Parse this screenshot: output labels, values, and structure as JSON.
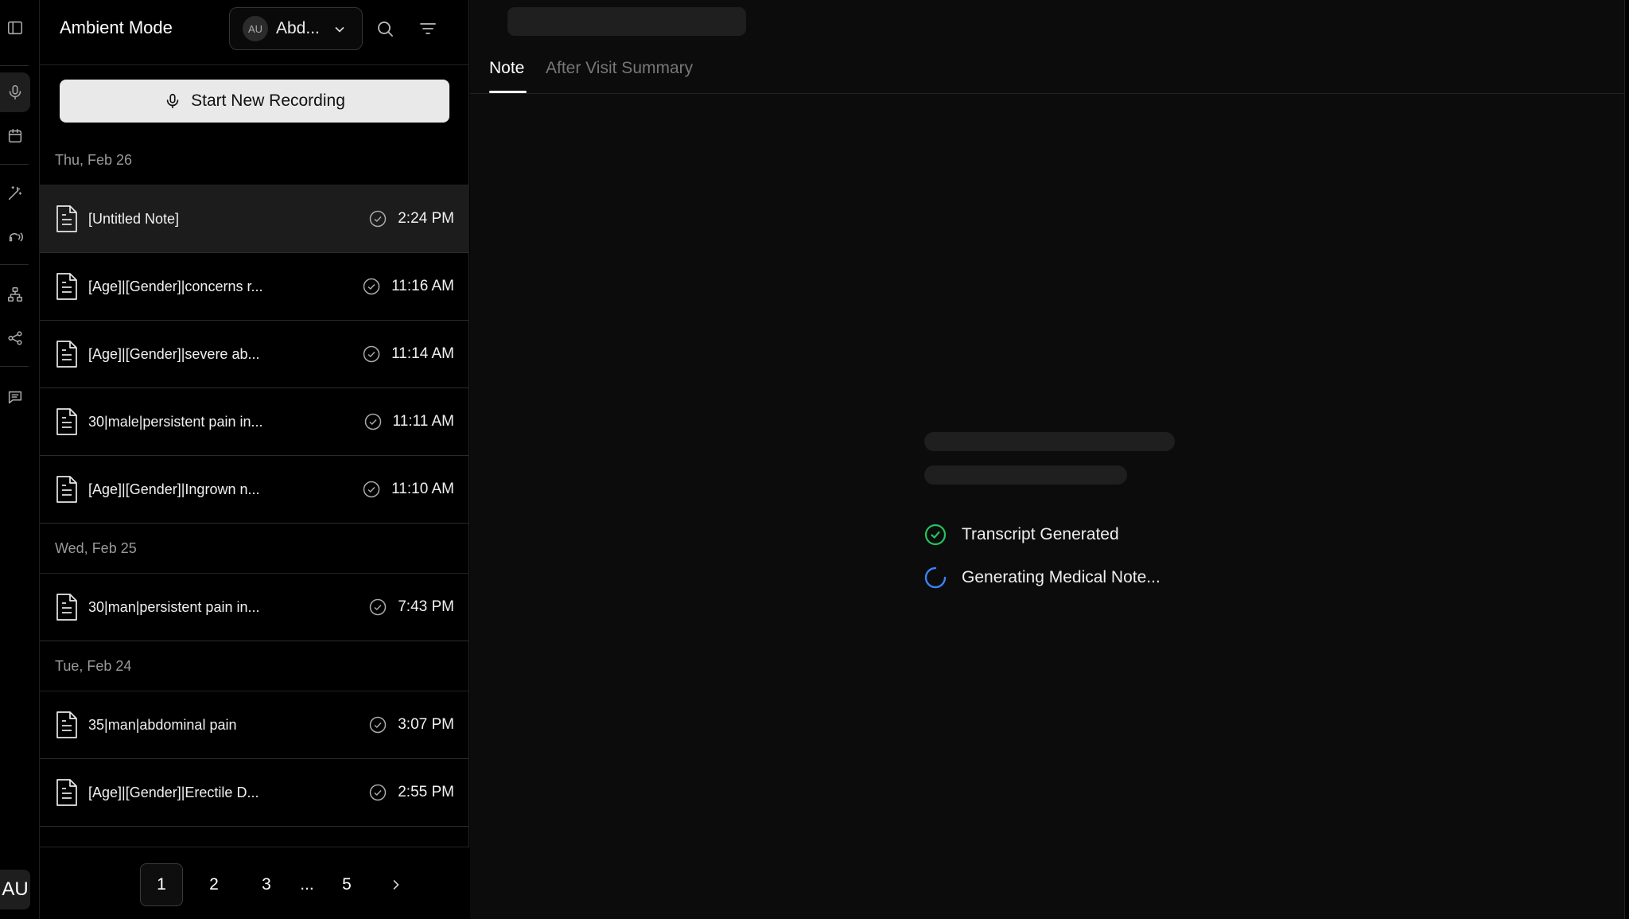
{
  "sidebar_panel": {
    "title": "Ambient Mode",
    "user": {
      "initials": "AU",
      "name": "Abd..."
    },
    "record_button_label": "Start New Recording"
  },
  "rail": {
    "avatar_initials": "AU"
  },
  "groups": [
    {
      "date": "Thu, Feb 26",
      "notes": [
        {
          "title": "[Untitled Note]",
          "time": "2:24 PM"
        },
        {
          "title": "[Age]|[Gender]|concerns r...",
          "time": "11:16 AM"
        },
        {
          "title": "[Age]|[Gender]|severe ab...",
          "time": "11:14 AM"
        },
        {
          "title": "30|male|persistent pain in...",
          "time": "11:11 AM"
        },
        {
          "title": "[Age]|[Gender]|Ingrown n...",
          "time": "11:10 AM"
        }
      ]
    },
    {
      "date": "Wed, Feb 25",
      "notes": [
        {
          "title": "30|man|persistent pain in...",
          "time": "7:43 PM"
        }
      ]
    },
    {
      "date": "Tue, Feb 24",
      "notes": [
        {
          "title": "35|man|abdominal pain",
          "time": "3:07 PM"
        },
        {
          "title": "[Age]|[Gender]|Erectile D...",
          "time": "2:55 PM"
        }
      ]
    }
  ],
  "pagination": {
    "pages": [
      "1",
      "2",
      "3",
      "...",
      "5"
    ],
    "current": "1"
  },
  "main": {
    "tabs": [
      {
        "label": "Note"
      },
      {
        "label": "After Visit Summary"
      }
    ],
    "status": [
      {
        "label": "Transcript Generated",
        "state": "done"
      },
      {
        "label": "Generating Medical Note...",
        "state": "loading"
      }
    ]
  },
  "colors": {
    "success": "#22c55e",
    "loading": "#3b82f6",
    "background": "#0c0c0c"
  }
}
